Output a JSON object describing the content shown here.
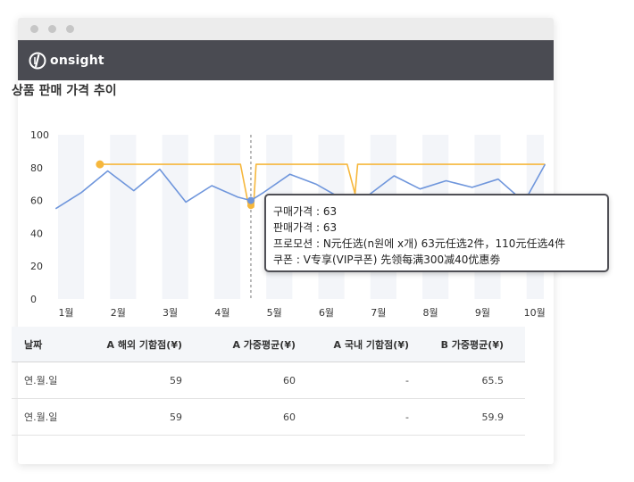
{
  "brand": {
    "name": "onsight"
  },
  "page": {
    "title": "상품 판매 가격 추이"
  },
  "colors": {
    "series_a": "#f6b73c",
    "series_b": "#6f96dc",
    "header_bg": "#4a4b52"
  },
  "chart_data": {
    "type": "line",
    "categories": [
      "1월",
      "2월",
      "3월",
      "4월",
      "5월",
      "6월",
      "7월",
      "8월",
      "9월",
      "10월"
    ],
    "ylim": [
      0,
      100
    ],
    "yticks": [
      "0",
      "20",
      "40",
      "60",
      "80",
      "100"
    ],
    "grid": "alternating vertical bands",
    "series": [
      {
        "name": "",
        "color": "#f6b73c",
        "x": [
          1.65,
          2,
          2.5,
          3,
          3.5,
          4,
          4.35,
          4.5,
          4.55,
          4.6,
          4.65,
          5,
          5.5,
          6,
          6.4,
          6.55,
          6.6,
          7,
          7.5,
          8,
          8.5,
          9,
          9.5,
          10.2
        ],
        "y": [
          82,
          82,
          82,
          82,
          82,
          82,
          82,
          58,
          57,
          56,
          82,
          82,
          82,
          82,
          82,
          64,
          82,
          82,
          82,
          82,
          82,
          82,
          82,
          82
        ]
      },
      {
        "name": "",
        "color": "#6f96dc",
        "x": [
          0.8,
          1.3,
          1.8,
          2.3,
          2.8,
          3.3,
          3.8,
          4.3,
          4.55,
          4.8,
          5.3,
          5.8,
          6.3,
          6.8,
          7.3,
          7.8,
          8.3,
          8.8,
          9.3,
          9.8,
          10.2
        ],
        "y": [
          55,
          65,
          78,
          66,
          79,
          59,
          69,
          62,
          60,
          65,
          76,
          70,
          61,
          63,
          75,
          67,
          72,
          68,
          73,
          59,
          82
        ]
      }
    ],
    "highlight": {
      "x": 4.55
    }
  },
  "tooltip": {
    "purchase_price": "구매가격 : 63",
    "sale_price": "판매가격 : 63",
    "promotion": "프로모션 : N元任选(n원에 x개) 63元任选2件，110元任选4件",
    "coupon": "쿠폰 : V专享(VIP쿠폰) 先领每满300减40优惠劵"
  },
  "table": {
    "headers": [
      "날짜",
      "A 해외 기함점(¥)",
      "A 가중평균(¥)",
      "A 국내 기함점(¥)",
      "B 가중평균(¥)"
    ],
    "rows": [
      [
        "연.월.일",
        "59",
        "60",
        "-",
        "65.5"
      ],
      [
        "연.월.일",
        "59",
        "60",
        "-",
        "59.9"
      ]
    ]
  }
}
